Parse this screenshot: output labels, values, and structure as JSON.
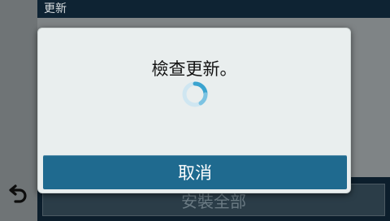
{
  "header": {
    "title": "更新"
  },
  "dialog": {
    "message": "檢查更新。",
    "cancel_label": "取消",
    "spinner_icon": "loading-spinner-icon"
  },
  "install": {
    "label": "安裝全部"
  },
  "nav": {
    "back_icon": "back-arrow-icon"
  },
  "colors": {
    "header_bg": "#0e2333",
    "dialog_bg": "#e9eeee",
    "button_bg": "#1f6a8f",
    "spinner": "#3aa3cf"
  }
}
